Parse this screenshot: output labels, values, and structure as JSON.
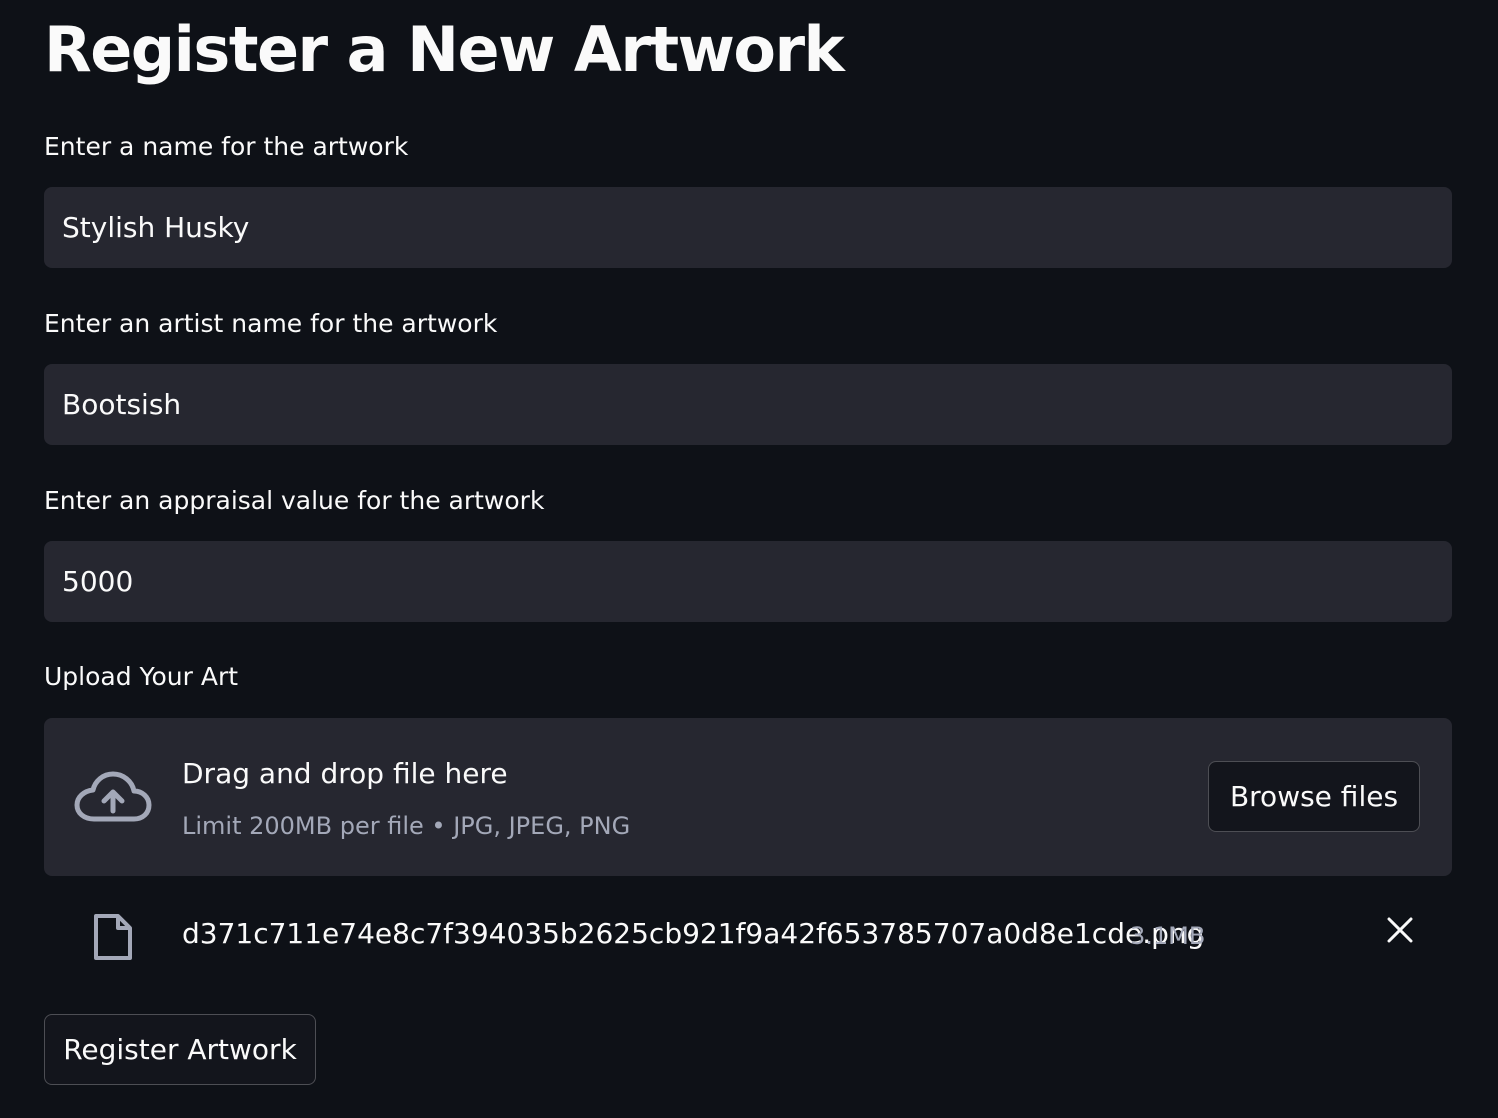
{
  "page": {
    "title": "Register a New Artwork"
  },
  "fields": [
    {
      "label": "Enter a name for the artwork",
      "value": "Stylish Husky"
    },
    {
      "label": "Enter an artist name for the artwork",
      "value": "Bootsish"
    },
    {
      "label": "Enter an appraisal value for the artwork",
      "value": "5000"
    }
  ],
  "upload": {
    "label": "Upload Your Art",
    "drop_text": "Drag and drop file here",
    "limit_text": "Limit 200MB per file • JPG, JPEG, PNG",
    "browse_label": "Browse files",
    "icon": "cloud-upload-icon",
    "file": {
      "name": "d371c711e74e8c7f394035b2625cb921f9a42f653785707a0d8e1cde.png",
      "size": "3.1MB",
      "icon": "file-icon",
      "remove_icon": "close-icon"
    }
  },
  "submit": {
    "label": "Register Artwork"
  },
  "colors": {
    "background": "#0e1117",
    "input_background": "#262730",
    "text": "#fafafa",
    "muted_text": "#a3a8b8"
  }
}
